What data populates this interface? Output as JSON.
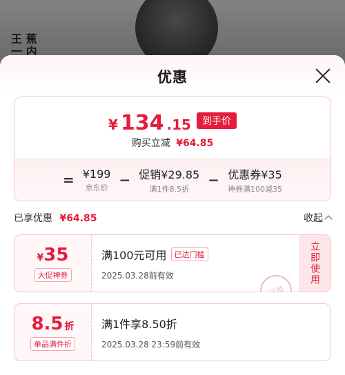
{
  "background": {
    "brand_line1": "王 蕉",
    "brand_line2": "一 内"
  },
  "sheet": {
    "title": "优惠"
  },
  "summary": {
    "currency": "¥",
    "price_int": "134",
    "price_dec": ".15",
    "price_tag": "到手价",
    "save_label": "购买立减",
    "save_amount": "¥64.85",
    "breakdown": [
      {
        "op": "=",
        "main": "¥199",
        "sub": "京东价"
      },
      {
        "op": "−",
        "main": "促销¥29.85",
        "sub": "满1件8.5折"
      },
      {
        "op": "−",
        "main": "优惠券¥35",
        "sub": "神券满100减35"
      }
    ]
  },
  "applied": {
    "label": "已享优惠",
    "amount": "¥64.85",
    "collapse_label": "收起"
  },
  "coupons": [
    {
      "sym": "¥",
      "amount": "35",
      "unit": "",
      "badge": "大促神券",
      "condition": "满100元可用",
      "tag": "已达门槛",
      "date": "2025.03.28前有效",
      "action": "立即使用",
      "stamp": "已领"
    },
    {
      "sym": "",
      "amount": "8.5",
      "unit": "折",
      "badge": "单品满件折",
      "condition": "满1件享8.50折",
      "tag": "",
      "date": "2025.03.28 23:59前有效",
      "action": "",
      "stamp": ""
    }
  ],
  "colors": {
    "accent": "#e31d3b",
    "card_border": "#f7c6cc",
    "card_bg": "#fff7f8"
  }
}
